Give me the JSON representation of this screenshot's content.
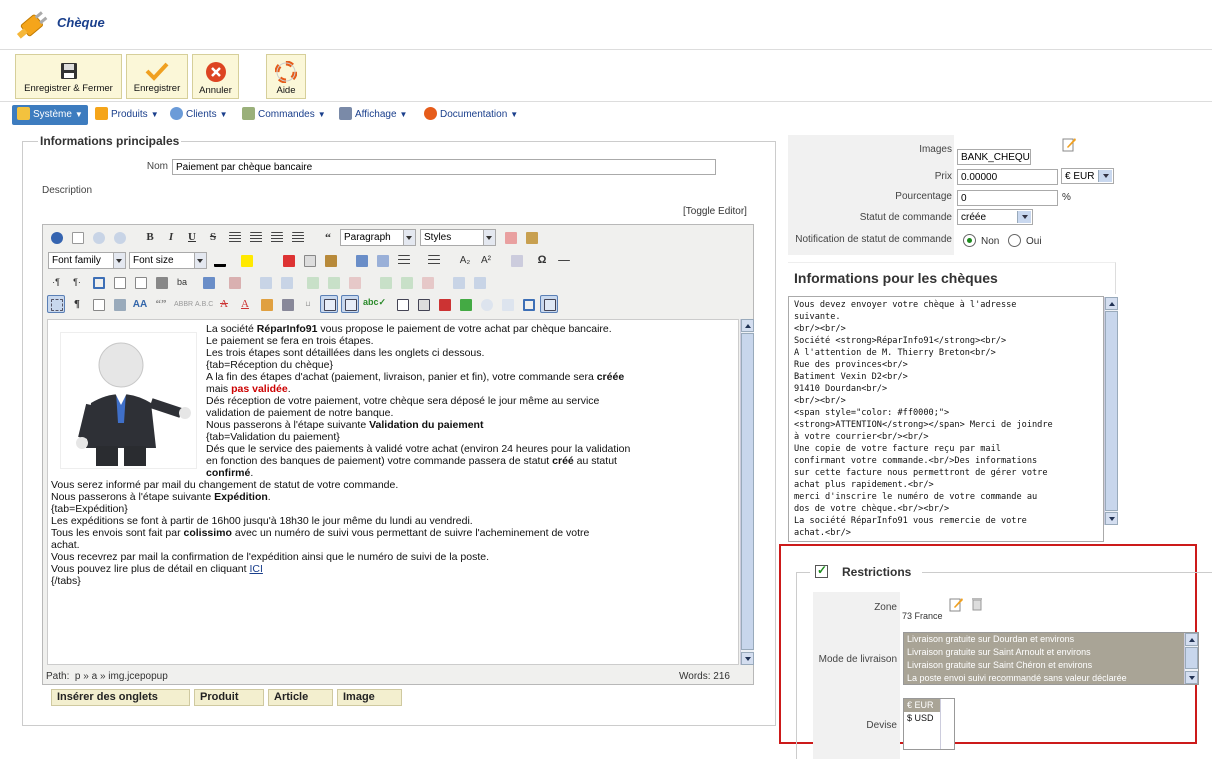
{
  "header": {
    "title": "Chèque"
  },
  "toolbar": {
    "save_close": "Enregistrer & Fermer",
    "save": "Enregistrer",
    "cancel": "Annuler",
    "help": "Aide"
  },
  "menu": {
    "systeme": "Système",
    "produits": "Produits",
    "clients": "Clients",
    "commandes": "Commandes",
    "affichage": "Affichage",
    "documentation": "Documentation"
  },
  "main": {
    "legend": "Informations principales",
    "nom_label": "Nom",
    "nom_value": "Paiement par chèque bancaire",
    "description_label": "Description",
    "toggle_editor": "[Toggle Editor]",
    "format_select": "Paragraph",
    "styles_select": "Styles",
    "font_family": "Font family",
    "font_size": "Font size",
    "path_label": "Path:",
    "path_value": "p » a » img.jcepopup",
    "words": "Words: 216",
    "tabs": [
      "Insérer des onglets",
      "Produit",
      "Article",
      "Image"
    ],
    "content": [
      [
        {
          "t": "La société "
        },
        {
          "t": "RéparInfo91",
          "b": true
        },
        {
          "t": " vous propose le paiement de votre achat par chèque bancaire."
        }
      ],
      [
        {
          "t": "Le paiement se fera en trois étapes."
        }
      ],
      [
        {
          "t": "Les trois étapes sont détaillées dans les onglets ci dessous."
        }
      ],
      [
        {
          "t": "{tab=Réception du chèque}"
        }
      ],
      [
        {
          "t": "A la fin des étapes d'achat (paiement, livraison, panier et fin), votre commande sera "
        },
        {
          "t": "créée",
          "b": true
        }
      ],
      [
        {
          "t": "mais "
        },
        {
          "t": "pas validée",
          "r": true
        },
        {
          "t": "."
        }
      ],
      [
        {
          "t": "Dés réception de votre paiement, votre chèque sera déposé le jour même au service"
        }
      ],
      [
        {
          "t": "validation de paiement de notre banque."
        }
      ],
      [
        {
          "t": "Nous passerons à l'étape suivante "
        },
        {
          "t": "Validation du paiement",
          "b": true
        }
      ],
      [
        {
          "t": "{tab=Validation du paiement}"
        }
      ],
      [
        {
          "t": "Dés que le service des paiements à validé votre achat (environ 24 heures pour la validation"
        }
      ],
      [
        {
          "t": "en fonction des banques de paiement) votre commande passera de statut "
        },
        {
          "t": "créé",
          "b": true
        },
        {
          "t": " au statut"
        }
      ],
      [
        {
          "t": "confirmé",
          "b": true
        },
        {
          "t": "."
        }
      ],
      [
        {
          "t": "Vous serez informé par mail du changement de statut de votre commande."
        }
      ],
      [
        {
          "t": "Nous passerons à l'étape suivante "
        },
        {
          "t": "Expédition",
          "b": true
        },
        {
          "t": "."
        }
      ],
      [
        {
          "t": "{tab=Expédition}"
        }
      ],
      [
        {
          "t": "Les expéditions se font à partir de 16h00 jusqu'à 18h30 le jour même du lundi au vendredi."
        }
      ],
      [
        {
          "t": "Tous les envois sont fait par "
        },
        {
          "t": "colissimo",
          "b": true
        },
        {
          "t": " avec un numéro de suivi vous permettant de suivre l'acheminement de votre"
        }
      ],
      [
        {
          "t": "achat."
        }
      ],
      [
        {
          "t": "Vous recevrez par mail la confirmation de l'expédition ainsi que le numéro de suivi de la poste."
        }
      ],
      [
        {
          "t": "Vous pouvez lire plus de détail en cliquant "
        },
        {
          "t": "ICI",
          "u": true
        }
      ],
      [
        {
          "t": "{/tabs}"
        }
      ]
    ]
  },
  "right": {
    "images_label": "Images",
    "images_value": "BANK_CHEQUE",
    "prix_label": "Prix",
    "prix_value": "0.00000",
    "currency": "€ EUR",
    "pourcentage_label": "Pourcentage",
    "pourcentage_value": "0",
    "percent_sign": "%",
    "statut_label": "Statut de commande",
    "statut_value": "créée",
    "notif_label": "Notification de statut de commande",
    "non": "Non",
    "oui": "Oui",
    "cheque_title": "Informations pour les chèques",
    "cheque_text": "Vous devez envoyer votre chèque à l'adresse\nsuivante.\n<br/><br/>\nSociété <strong>RéparInfo91</strong><br/>\nA l'attention de M. Thierry Breton<br/>\nRue des provinces<br/>\nBatiment Vexin D2<br/>\n91410 Dourdan<br/>\n<br/><br/>\n<span style=\"color: #ff0000;\">\n<strong>ATTENTION</strong></span> Merci de joindre\nà votre courrier<br/><br/>\nUne copie de votre facture reçu par mail\nconfirmant votre commande.<br/>Des informations\nsur cette facture nous permettront de gérer votre\nachat plus rapidement.<br/>\nmerci d'inscrire le numéro de votre commande au\ndos de votre chèque.<br/><br/>\nLa société RéparInfo91 vous remercie de votre\nachat.<br/>",
    "restrictions": "Restrictions",
    "zone_label": "Zone",
    "zone_value": "73 France",
    "livraison_label": "Mode de livraison",
    "livraison_options": [
      "Livraison gratuite sur Dourdan et environs",
      "Livraison gratuite sur Saint Arnoult et environs",
      "Livraison gratuite sur Saint Chéron et environs",
      "La poste envoi suivi recommandé sans valeur déclarée"
    ],
    "devise_label": "Devise",
    "devise_options": [
      "€ EUR",
      "$ USD"
    ]
  }
}
